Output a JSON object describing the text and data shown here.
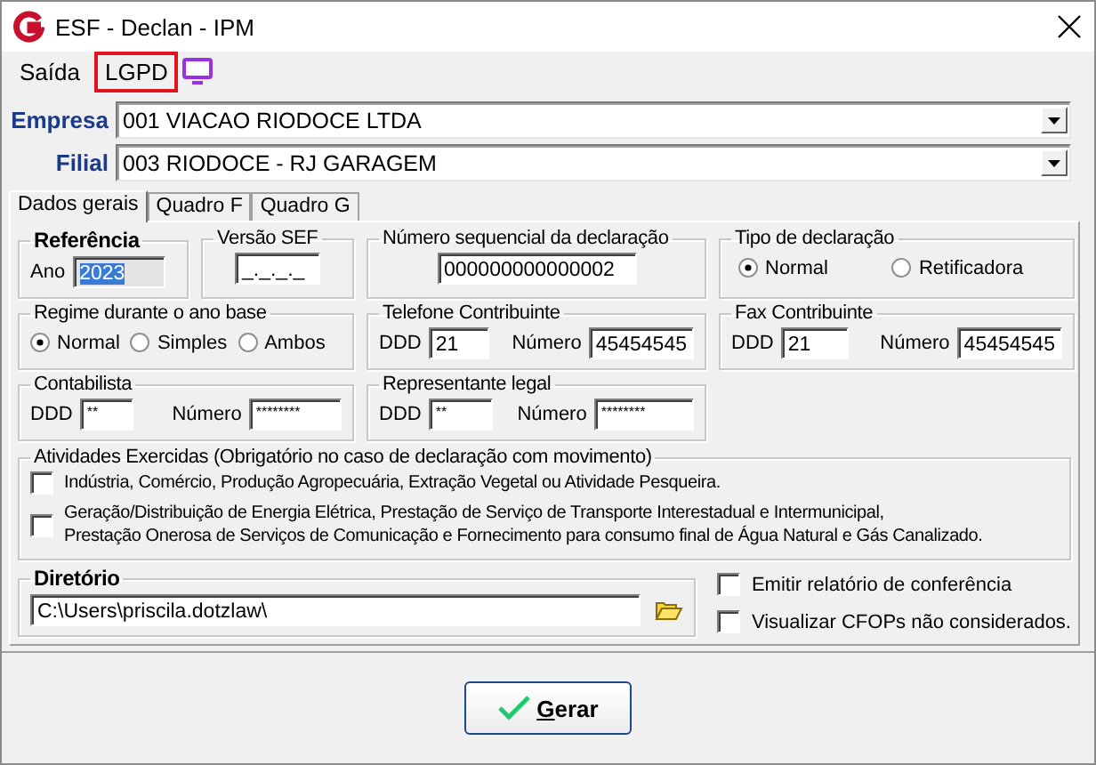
{
  "window": {
    "title": "ESF - Declan - IPM"
  },
  "menu": [
    {
      "label": "Saída",
      "highlighted": false
    },
    {
      "label": "LGPD",
      "highlighted": true
    }
  ],
  "empresa": {
    "label": "Empresa",
    "value": "001 VIACAO RIODOCE LTDA"
  },
  "filial": {
    "label": "Filial",
    "value": "003 RIODOCE - RJ GARAGEM"
  },
  "tabs": [
    {
      "label": "Dados gerais",
      "selected": true
    },
    {
      "label": "Quadro F",
      "selected": false
    },
    {
      "label": "Quadro G",
      "selected": false
    }
  ],
  "referencia": {
    "title": "Referência",
    "label": "Ano",
    "value": "2023",
    "highlighted": true
  },
  "versao_sef": {
    "title": "Versão SEF",
    "value": "_._._._"
  },
  "numero_sequencial": {
    "title": "Número sequencial da declaração",
    "value": "000000000000002"
  },
  "tipo_declaracao": {
    "title": "Tipo de declaração",
    "options": [
      {
        "label": "Normal",
        "selected": true
      },
      {
        "label": "Retificadora",
        "selected": false
      }
    ]
  },
  "regime": {
    "title": "Regime durante o ano base",
    "options": [
      {
        "label": "Normal",
        "selected": true
      },
      {
        "label": "Simples",
        "selected": false
      },
      {
        "label": "Ambos",
        "selected": false
      }
    ]
  },
  "telefone": {
    "title": "Telefone Contribuinte",
    "ddd_label": "DDD",
    "ddd": "21",
    "numero_label": "Número",
    "numero": "45454545"
  },
  "fax": {
    "title": "Fax Contribuinte",
    "ddd_label": "DDD",
    "ddd": "21",
    "numero_label": "Número",
    "numero": "45454545"
  },
  "contabilista": {
    "title": "Contabilista",
    "ddd_label": "DDD",
    "ddd": "**",
    "numero_label": "Número",
    "numero": "********"
  },
  "representante": {
    "title": "Representante legal",
    "ddd_label": "DDD",
    "ddd": "**",
    "numero_label": "Número",
    "numero": "********"
  },
  "atividades": {
    "title": "Atividades Exercidas (Obrigatório no caso de declaração com movimento)",
    "items": [
      {
        "label": "Indústria, Comércio, Produção Agropecuária, Extração Vegetal ou Atividade Pesqueira.",
        "checked": false
      },
      {
        "label": "Geração/Distribuição de Energia Elétrica, Prestação de Serviço de Transporte Interestadual e Intermunicipal,\nPrestação Onerosa de Serviços de Comunicação e Fornecimento para consumo final de Água Natural e Gás Canalizado.",
        "checked": false
      }
    ]
  },
  "diretorio": {
    "title": "Diretório",
    "value": "C:\\Users\\priscila.dotzlaw\\"
  },
  "options": [
    {
      "label": "Emitir relatório de conferência",
      "checked": false
    },
    {
      "label": "Visualizar CFOPs não considerados.",
      "checked": false
    }
  ],
  "gerar_button": {
    "label": "Gerar"
  }
}
